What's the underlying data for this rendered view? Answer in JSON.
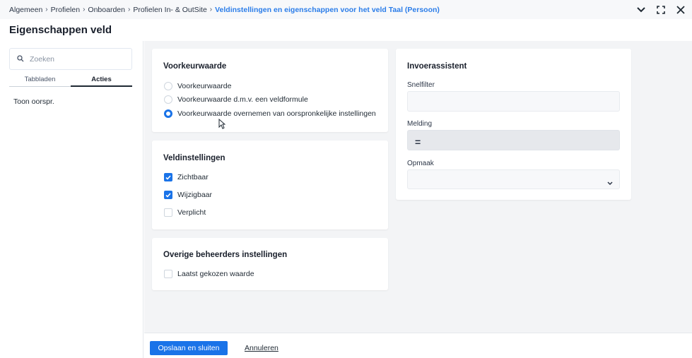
{
  "breadcrumb": {
    "items": [
      "Algemeen",
      "Profielen",
      "Onboarden",
      "Profielen In- & OutSite"
    ],
    "current": "Veldinstellingen en eigenschappen voor het veld Taal (Persoon)",
    "separator": "›"
  },
  "window_controls": {
    "collapse_icon": "chevron-down-icon",
    "fullscreen_icon": "expand-icon",
    "close_icon": "close-icon"
  },
  "page": {
    "title": "Eigenschappen veld"
  },
  "sidebar": {
    "search_placeholder": "Zoeken",
    "tabs": [
      {
        "label": "Tabbladen",
        "active": false
      },
      {
        "label": "Acties",
        "active": true
      }
    ],
    "actions": [
      "Toon oorspr."
    ]
  },
  "voorkeur": {
    "title": "Voorkeurwaarde",
    "options": [
      {
        "label": "Voorkeurwaarde",
        "selected": false
      },
      {
        "label": "Voorkeurwaarde d.m.v. een veldformule",
        "selected": false
      },
      {
        "label": "Voorkeurwaarde overnemen van oorspronkelijke instellingen",
        "selected": true
      }
    ]
  },
  "veld": {
    "title": "Veldinstellingen",
    "options": [
      {
        "label": "Zichtbaar",
        "checked": true
      },
      {
        "label": "Wijzigbaar",
        "checked": true
      },
      {
        "label": "Verplicht",
        "checked": false
      }
    ]
  },
  "overige": {
    "title": "Overige beheerders instellingen",
    "options": [
      {
        "label": "Laatst gekozen waarde",
        "checked": false
      }
    ]
  },
  "invoer": {
    "title": "Invoerassistent",
    "snelfilter_label": "Snelfilter",
    "snelfilter_value": "",
    "melding_label": "Melding",
    "melding_value": "=",
    "opmaak_label": "Opmaak",
    "opmaak_value": ""
  },
  "footer": {
    "save_label": "Opslaan en sluiten",
    "cancel_label": "Annuleren"
  },
  "colors": {
    "accent": "#1a73e8",
    "breadcrumb_current": "#2b7de9",
    "background": "#f3f4f6"
  }
}
